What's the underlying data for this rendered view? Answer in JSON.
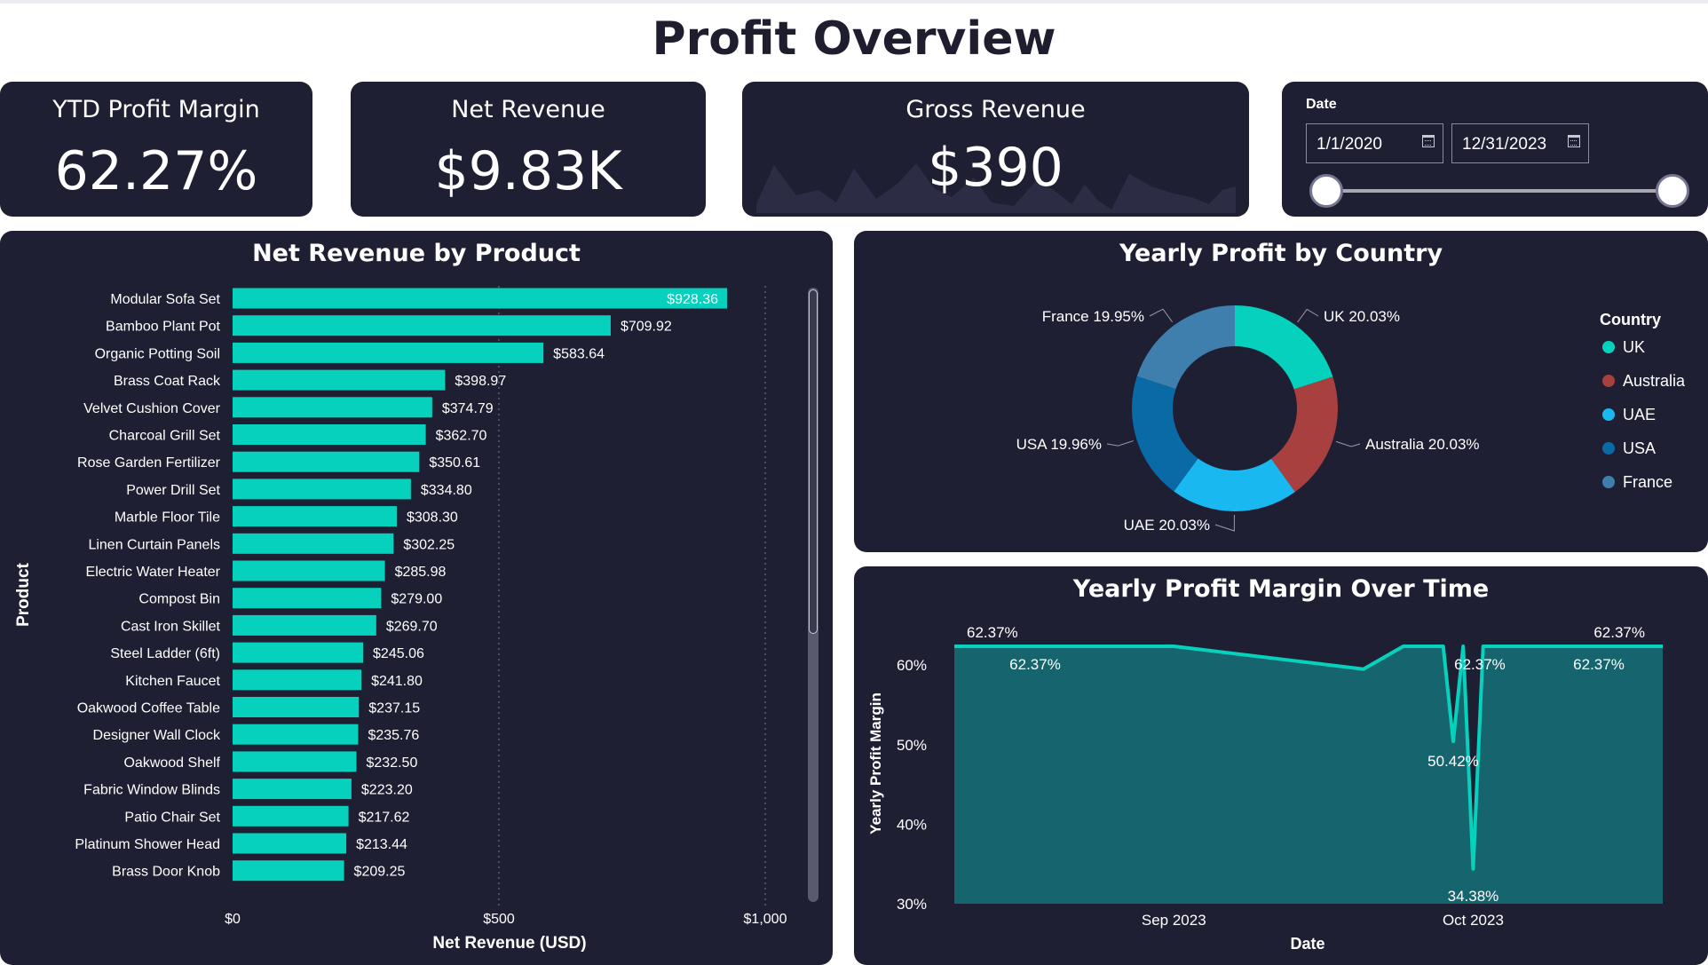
{
  "page": {
    "title": "Profit Overview"
  },
  "kpis": {
    "ytd_profit_margin": {
      "label": "YTD Profit Margin",
      "value": "62.27%"
    },
    "net_revenue": {
      "label": "Net Revenue",
      "value": "$9.83K"
    },
    "gross_revenue": {
      "label": "Gross Revenue",
      "value": "$390"
    }
  },
  "date_filter": {
    "label": "Date",
    "start": "1/1/2020",
    "end": "12/31/2023",
    "icon": "calendar-icon"
  },
  "colors": {
    "background": "#ffffff",
    "card": "#1f1f33",
    "accent_teal": "#05d1bd",
    "area_fill": "#16656e",
    "uk": "#05d1bd",
    "australia": "#a8403f",
    "uae": "#1ab8f0",
    "usa": "#0a6aa6",
    "france": "#3f7fae"
  },
  "chart_data": [
    {
      "type": "bar",
      "orientation": "horizontal",
      "title": "Net Revenue by Product",
      "xlabel": "Net Revenue (USD)",
      "ylabel": "Product",
      "xlim": [
        0,
        1000
      ],
      "x_ticks": [
        "$0",
        "$500",
        "$1,000"
      ],
      "grid": true,
      "categories": [
        "Modular Sofa Set",
        "Bamboo Plant Pot",
        "Organic Potting Soil",
        "Brass Coat Rack",
        "Velvet Cushion Cover",
        "Charcoal Grill Set",
        "Rose Garden Fertilizer",
        "Power Drill Set",
        "Marble Floor Tile",
        "Linen Curtain Panels",
        "Electric Water Heater",
        "Compost Bin",
        "Cast Iron Skillet",
        "Steel Ladder (6ft)",
        "Kitchen Faucet",
        "Oakwood Coffee Table",
        "Designer Wall Clock",
        "Oakwood Shelf",
        "Fabric Window Blinds",
        "Patio Chair Set",
        "Platinum Shower Head",
        "Brass Door Knob"
      ],
      "values": [
        928.36,
        709.92,
        583.64,
        398.97,
        374.79,
        362.7,
        350.61,
        334.8,
        308.3,
        302.25,
        285.98,
        279.0,
        269.7,
        245.06,
        241.8,
        237.15,
        235.76,
        232.5,
        223.2,
        217.62,
        213.44,
        209.25
      ],
      "labels": [
        "$928.36",
        "$709.92",
        "$583.64",
        "$398.97",
        "$374.79",
        "$362.70",
        "$350.61",
        "$334.80",
        "$308.30",
        "$302.25",
        "$285.98",
        "$279.00",
        "$269.70",
        "$245.06",
        "$241.80",
        "$237.15",
        "$235.76",
        "$232.50",
        "$223.20",
        "$217.62",
        "$213.44",
        "$209.25"
      ]
    },
    {
      "type": "pie",
      "subtype": "donut",
      "title": "Yearly Profit by Country",
      "legend_title": "Country",
      "legend_position": "right",
      "categories": [
        "UK",
        "Australia",
        "UAE",
        "USA",
        "France"
      ],
      "values": [
        20.03,
        20.03,
        20.03,
        19.96,
        19.95
      ],
      "labels": [
        "UK 20.03%",
        "Australia 20.03%",
        "UAE 20.03%",
        "USA 19.96%",
        "France 19.95%"
      ],
      "colors": [
        "#05d1bd",
        "#a8403f",
        "#1ab8f0",
        "#0a6aa6",
        "#3f7fae"
      ]
    },
    {
      "type": "area",
      "title": "Yearly Profit Margin Over Time",
      "xlabel": "Date",
      "ylabel": "Yearly Profit Margin",
      "ylim": [
        30,
        62.37
      ],
      "y_ticks": [
        "30%",
        "40%",
        "50%",
        "60%"
      ],
      "x_ticks": [
        "Sep 2023",
        "Oct 2023"
      ],
      "x": [
        "2023-08-10",
        "2023-09-01",
        "2023-09-20",
        "2023-09-24",
        "2023-09-26",
        "2023-09-28",
        "2023-09-29",
        "2023-09-30",
        "2023-10-01",
        "2023-10-02",
        "2023-10-03",
        "2023-10-20"
      ],
      "values": [
        62.37,
        62.37,
        59.5,
        62.37,
        62.37,
        62.37,
        50.42,
        62.37,
        34.38,
        62.37,
        62.37,
        62.37
      ],
      "data_labels": [
        "62.37%",
        "62.37%",
        "62.37%",
        "62.37%",
        "50.42%",
        "34.38%",
        "62.37%"
      ]
    }
  ]
}
